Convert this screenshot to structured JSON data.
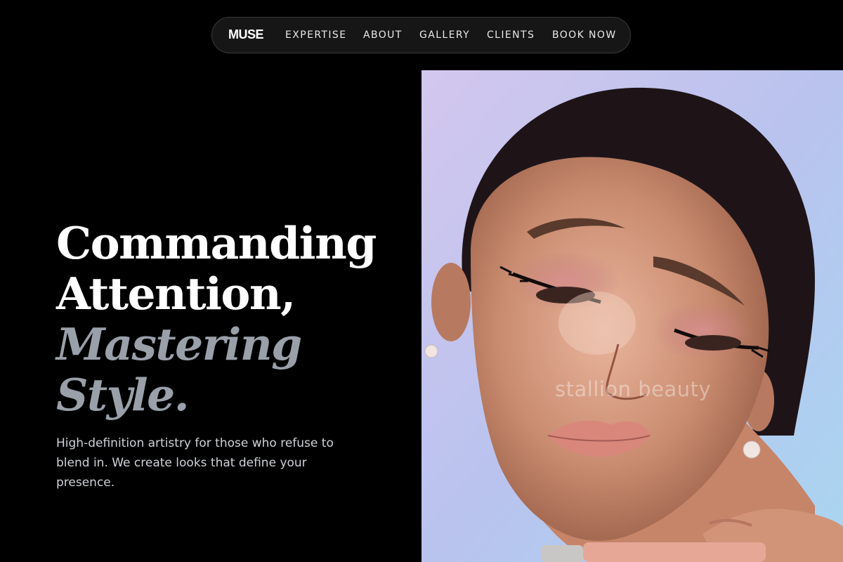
{
  "nav": {
    "brand": "MUSE",
    "links": [
      "EXPERTISE",
      "ABOUT",
      "GALLERY",
      "CLIENTS",
      "BOOK NOW"
    ]
  },
  "hero": {
    "title_line1": "Commanding",
    "title_line2": "Attention,",
    "title_line3": "Mastering",
    "title_line4": "Style.",
    "subtitle": "High-definition artistry for those who refuse to blend in. We create looks that define your presence."
  },
  "portrait": {
    "watermark": "stallion beauty"
  },
  "colors": {
    "background": "#000000",
    "nav_bg": "#161616",
    "accent_text": "#9aa0aa"
  }
}
